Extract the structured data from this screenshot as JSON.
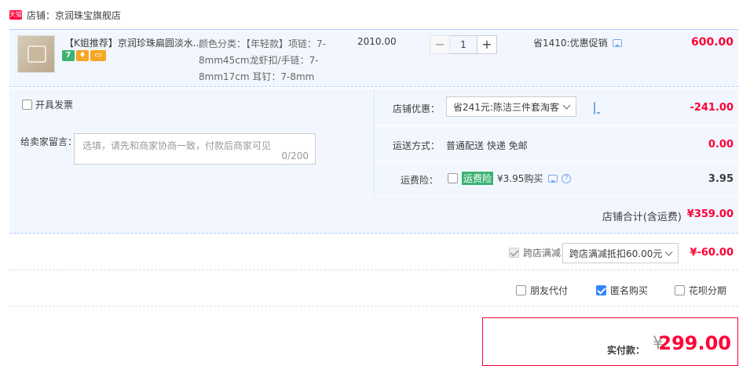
{
  "shop": {
    "badge": "天猫",
    "label": "店铺：京润珠宝旗舰店"
  },
  "item": {
    "title": "【K姐推荐】京润珍珠扁圆淡水...",
    "badges": [
      "7",
      "",
      ""
    ],
    "sku_text": "颜色分类：【年轻款】项链：7-8mm45cm龙虾扣/手链：7-8mm17cm 耳钉：7-8mm",
    "unit_price": "2010.00",
    "quantity": "1",
    "minus": "−",
    "plus": "+",
    "promo": "省1410:优惠促销",
    "total": "600.00"
  },
  "invoice_label": "开具发票",
  "message": {
    "label": "给卖家留言：",
    "placeholder": "选填，请先和商家协商一致，付款后商家可见",
    "count": "0/200"
  },
  "shop_discount": {
    "label": "店铺优惠：",
    "selected": "省241元:陈洁三件套淘客",
    "value": "-241.00"
  },
  "shipping": {
    "label": "运送方式：",
    "value_text": "普通配送 快递 免邮",
    "value": "0.00"
  },
  "insurance": {
    "label": "运费险：",
    "tag": "运费险",
    "text": "¥3.95购买",
    "help": "?",
    "value": "3.95"
  },
  "shop_total": {
    "label": "店铺合计(含运费)",
    "value": "¥359.00"
  },
  "cross_store": {
    "label": "跨店满减",
    "selected": "跨店满减抵扣60.00元",
    "value": "¥-60.00"
  },
  "options": [
    {
      "label": "朋友代付",
      "checked": false
    },
    {
      "label": "匿名购买",
      "checked": true
    },
    {
      "label": "花呗分期",
      "checked": false
    }
  ],
  "payment": {
    "label": "实付款：",
    "currency": "¥",
    "amount": "299.00"
  },
  "colors": {
    "accent": "#ff0036",
    "row_bg": "#f2f7ff",
    "checkbox": "#3385ff"
  }
}
